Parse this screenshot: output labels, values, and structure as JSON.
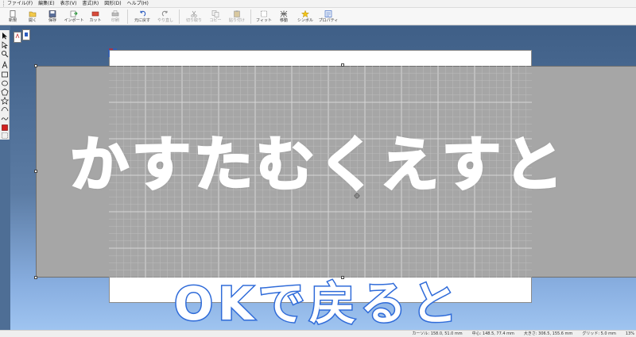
{
  "menu": [
    "ファイル(F)",
    "編集(E)",
    "表示(V)",
    "書式(R)",
    "図形(D)",
    "ヘルプ(H)"
  ],
  "toolbar": [
    {
      "label": "新規",
      "icon": "new-file-icon",
      "enabled": true
    },
    {
      "label": "開く",
      "icon": "open-folder-icon",
      "enabled": true
    },
    {
      "label": "保存",
      "icon": "save-icon",
      "enabled": true
    },
    {
      "label": "インポート",
      "icon": "import-icon",
      "enabled": true
    },
    {
      "label": "カット",
      "icon": "cut-icon",
      "enabled": true
    },
    {
      "label": "印刷",
      "icon": "print-icon",
      "enabled": false
    },
    {
      "label": "元に戻す",
      "icon": "undo-icon",
      "enabled": true
    },
    {
      "label": "やり直し",
      "icon": "redo-icon",
      "enabled": false
    },
    {
      "label": "切り取り",
      "icon": "scissors-icon",
      "enabled": false
    },
    {
      "label": "コピー",
      "icon": "copy-icon",
      "enabled": false
    },
    {
      "label": "貼り付け",
      "icon": "paste-icon",
      "enabled": false
    },
    {
      "label": "フィット",
      "icon": "fit-icon",
      "enabled": true
    },
    {
      "label": "移動",
      "icon": "move-icon",
      "enabled": true
    },
    {
      "label": "シンボル",
      "icon": "star-icon",
      "enabled": true
    },
    {
      "label": "プロパティ",
      "icon": "properties-icon",
      "enabled": true
    }
  ],
  "palette_tools": [
    "select-arrow-icon",
    "node-select-icon",
    "zoom-icon",
    "text-tool-icon",
    "rectangle-icon",
    "ellipse-icon",
    "polygon-icon",
    "star-shape-icon",
    "curve-icon",
    "freehand-icon",
    "fill-color-icon",
    "grid-toggle-icon"
  ],
  "overlay": {
    "main_caption": "かすたむくえすと",
    "sub_caption": "OKで戻ると"
  },
  "status": {
    "cursor": "カーソル: 158.0, 51.0 mm",
    "center": "中心: 148.5, 77.4 mm",
    "size": "大きさ: 306.5, 155.6 mm",
    "grid": "グリッド: 5.0 mm",
    "zoom": "13%"
  },
  "colors": {
    "workspace_top": "#3f5f87",
    "workspace_bottom": "#9fc4f0",
    "caption_outline": "#2f6bd9",
    "selected_color": "#d22020"
  }
}
